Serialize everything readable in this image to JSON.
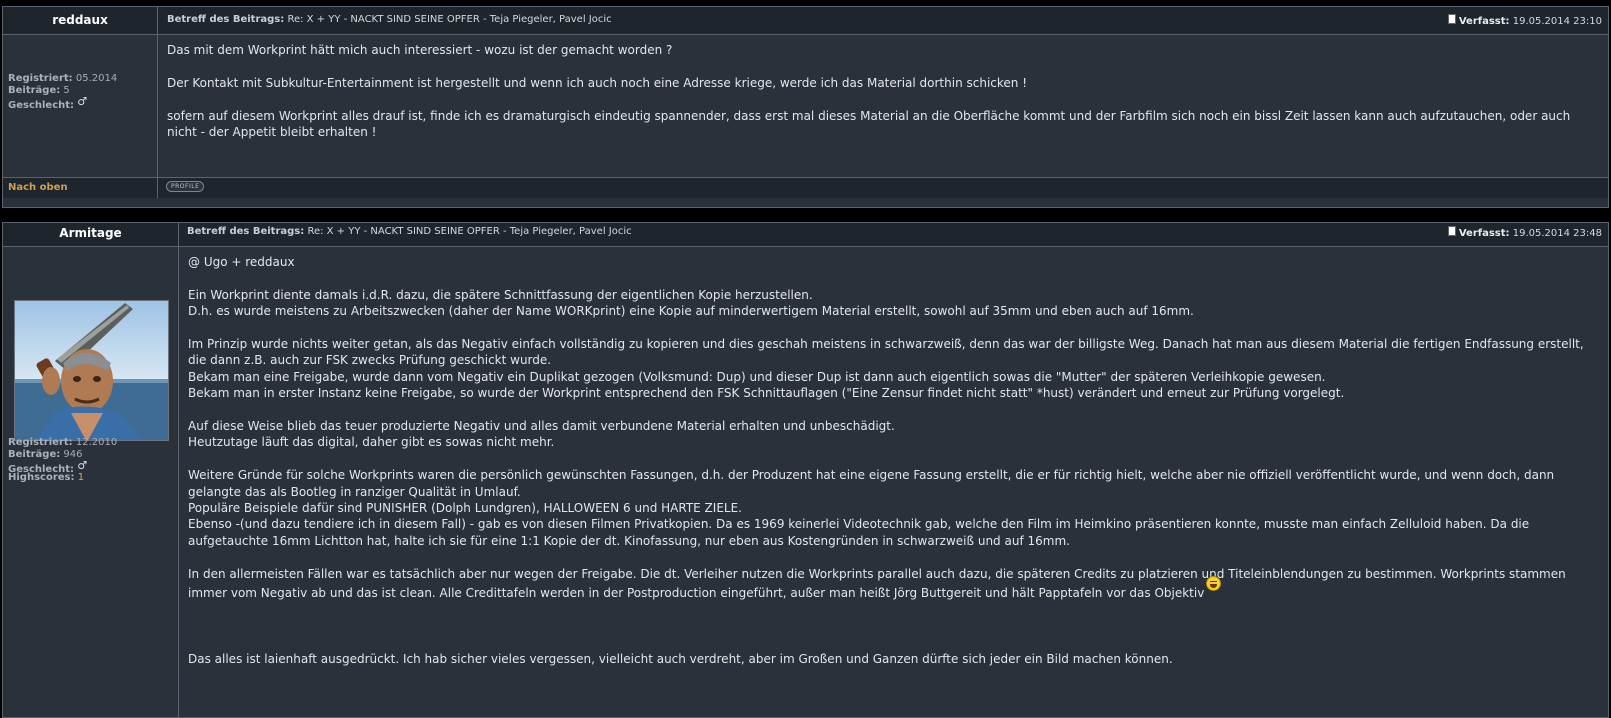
{
  "posts": [
    {
      "author": "reddaux",
      "subject_label": "Betreff des Beitrags:",
      "subject": "Re: X + YY - NACKT SIND SEINE OPFER - Teja Piegeler, Pavel Jocic",
      "posted_label": "Verfasst:",
      "posted": "19.05.2014 23:10",
      "stats": {
        "registered_label": "Registriert:",
        "registered": "05.2014",
        "posts_label": "Beiträge:",
        "posts": "5",
        "gender_label": "Geschlecht:"
      },
      "body": [
        "Das mit dem Workprint hätt mich auch interessiert - wozu ist der gemacht worden ?",
        "",
        "Der Kontakt mit Subkultur-Entertainment ist hergestellt und wenn ich auch noch eine Adresse kriege, werde ich das Material dorthin schicken !",
        "",
        "sofern auf diesem Workprint alles drauf ist, finde ich es dramaturgisch eindeutig spannender, dass erst mal dieses Material an die Oberfläche kommt und der Farbfilm sich noch ein bissl Zeit lassen kann auch aufzutauchen, oder auch nicht - der Appetit bleibt erhalten !"
      ],
      "footer": {
        "nach_oben": "Nach oben",
        "profile": "PROFILE"
      }
    },
    {
      "author": "Armitage",
      "subject_label": "Betreff des Beitrags:",
      "subject": "Re: X + YY - NACKT SIND SEINE OPFER - Teja Piegeler, Pavel Jocic",
      "posted_label": "Verfasst:",
      "posted": "19.05.2014 23:48",
      "stats": {
        "registered_label": "Registriert:",
        "registered": "12.2010",
        "posts_label": "Beiträge:",
        "posts": "946",
        "gender_label": "Geschlecht:",
        "highscores_label": "Highscores:",
        "highscores": "1"
      },
      "body": [
        "@ Ugo + reddaux",
        "",
        "Ein Workprint diente damals i.d.R. dazu, die spätere Schnittfassung der eigentlichen Kopie herzustellen.",
        "D.h. es wurde meistens zu Arbeitszwecken (daher der Name WORKprint) eine Kopie auf minderwertigem Material erstellt, sowohl auf 35mm und eben auch auf 16mm.",
        "",
        "Im Prinzip wurde nichts weiter getan, als das Negativ einfach vollständig zu kopieren und dies geschah meistens in schwarzweiß, denn das war der billigste Weg. Danach hat man aus diesem Material die fertigen Endfassung erstellt, die dann z.B. auch zur FSK zwecks Prüfung geschickt wurde.",
        "Bekam man eine Freigabe, wurde dann vom Negativ ein Duplikat gezogen (Volksmund: Dup) und dieser Dup ist dann auch eigentlich sowas die \"Mutter\" der späteren Verleihkopie gewesen.",
        "Bekam man in erster Instanz keine Freigabe, so wurde der Workprint entsprechend den FSK Schnittauflagen (\"Eine Zensur findet nicht statt\" *hust) verändert und erneut zur Prüfung vorgelegt.",
        "",
        "Auf diese Weise blieb das teuer produzierte Negativ und alles damit verbundene Material erhalten und unbeschädigt.",
        "Heutzutage läuft das digital, daher gibt es sowas nicht mehr.",
        "",
        "Weitere Gründe für solche Workprints waren die persönlich gewünschten Fassungen, d.h. der Produzent hat eine eigene Fassung erstellt, die er für richtig hielt, welche aber nie offiziell veröffentlicht wurde, und wenn doch, dann gelangte das als Bootleg in ranziger Qualität in Umlauf.",
        "Populäre Beispiele dafür sind PUNISHER (Dolph Lundgren), HALLOWEEN 6 und HARTE ZIELE.",
        "Ebenso -(und dazu tendiere ich in diesem Fall) - gab es von diesen Filmen Privatkopien. Da es 1969 keinerlei Videotechnik gab, welche den Film im Heimkino präsentieren konnte, musste man einfach Zelluloid haben. Da die aufgetauchte 16mm Lichtton hat, halte ich sie für eine 1:1 Kopie der dt. Kinofassung, nur eben aus Kostengründen in schwarzweiß und auf 16mm.",
        "",
        "In den allermeisten Fällen war es tatsächlich aber nur wegen der Freigabe. Die dt. Verleiher nutzen die Workprints parallel auch dazu, die späteren Credits zu platzieren und Titeleinblendungen zu bestimmen. Workprints stammen immer vom Negativ ab und das ist clean. Alle Credittafeln werden in der Postproduction eingeführt, außer man heißt Jörg Buttgereit und hält Papptafeln vor das Objektiv"
      ],
      "body_last": "Das alles ist laienhaft ausgedrückt. Ich hab sicher vieles vergessen, vielleicht auch verdreht, aber im Großen und Ganzen dürfte sich jeder ein Bild machen können."
    }
  ]
}
